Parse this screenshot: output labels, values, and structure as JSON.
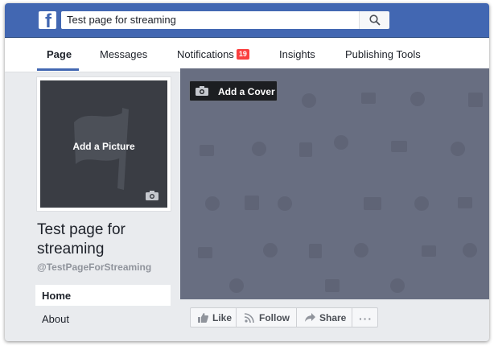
{
  "topbar": {
    "logo_letter": "f",
    "search_value": "Test page for streaming",
    "search_icon": "search-icon"
  },
  "tabs": [
    {
      "label": "Page",
      "active": true
    },
    {
      "label": "Messages",
      "active": false
    },
    {
      "label": "Notifications",
      "active": false,
      "badge": "19"
    },
    {
      "label": "Insights",
      "active": false
    },
    {
      "label": "Publishing Tools",
      "active": false
    }
  ],
  "profile": {
    "add_picture_label": "Add a Picture",
    "page_name": "Test page for streaming",
    "username": "@TestPageForStreaming"
  },
  "left_nav": [
    {
      "label": "Home",
      "active": true
    },
    {
      "label": "About",
      "active": false
    }
  ],
  "cover": {
    "add_cover_label": "Add a Cover"
  },
  "actions": {
    "like_label": "Like",
    "follow_label": "Follow",
    "share_label": "Share",
    "more_label": "···"
  },
  "colors": {
    "brand_blue": "#4267b2",
    "cover_bg": "#686e81",
    "badge_red": "#fa3e3e"
  }
}
